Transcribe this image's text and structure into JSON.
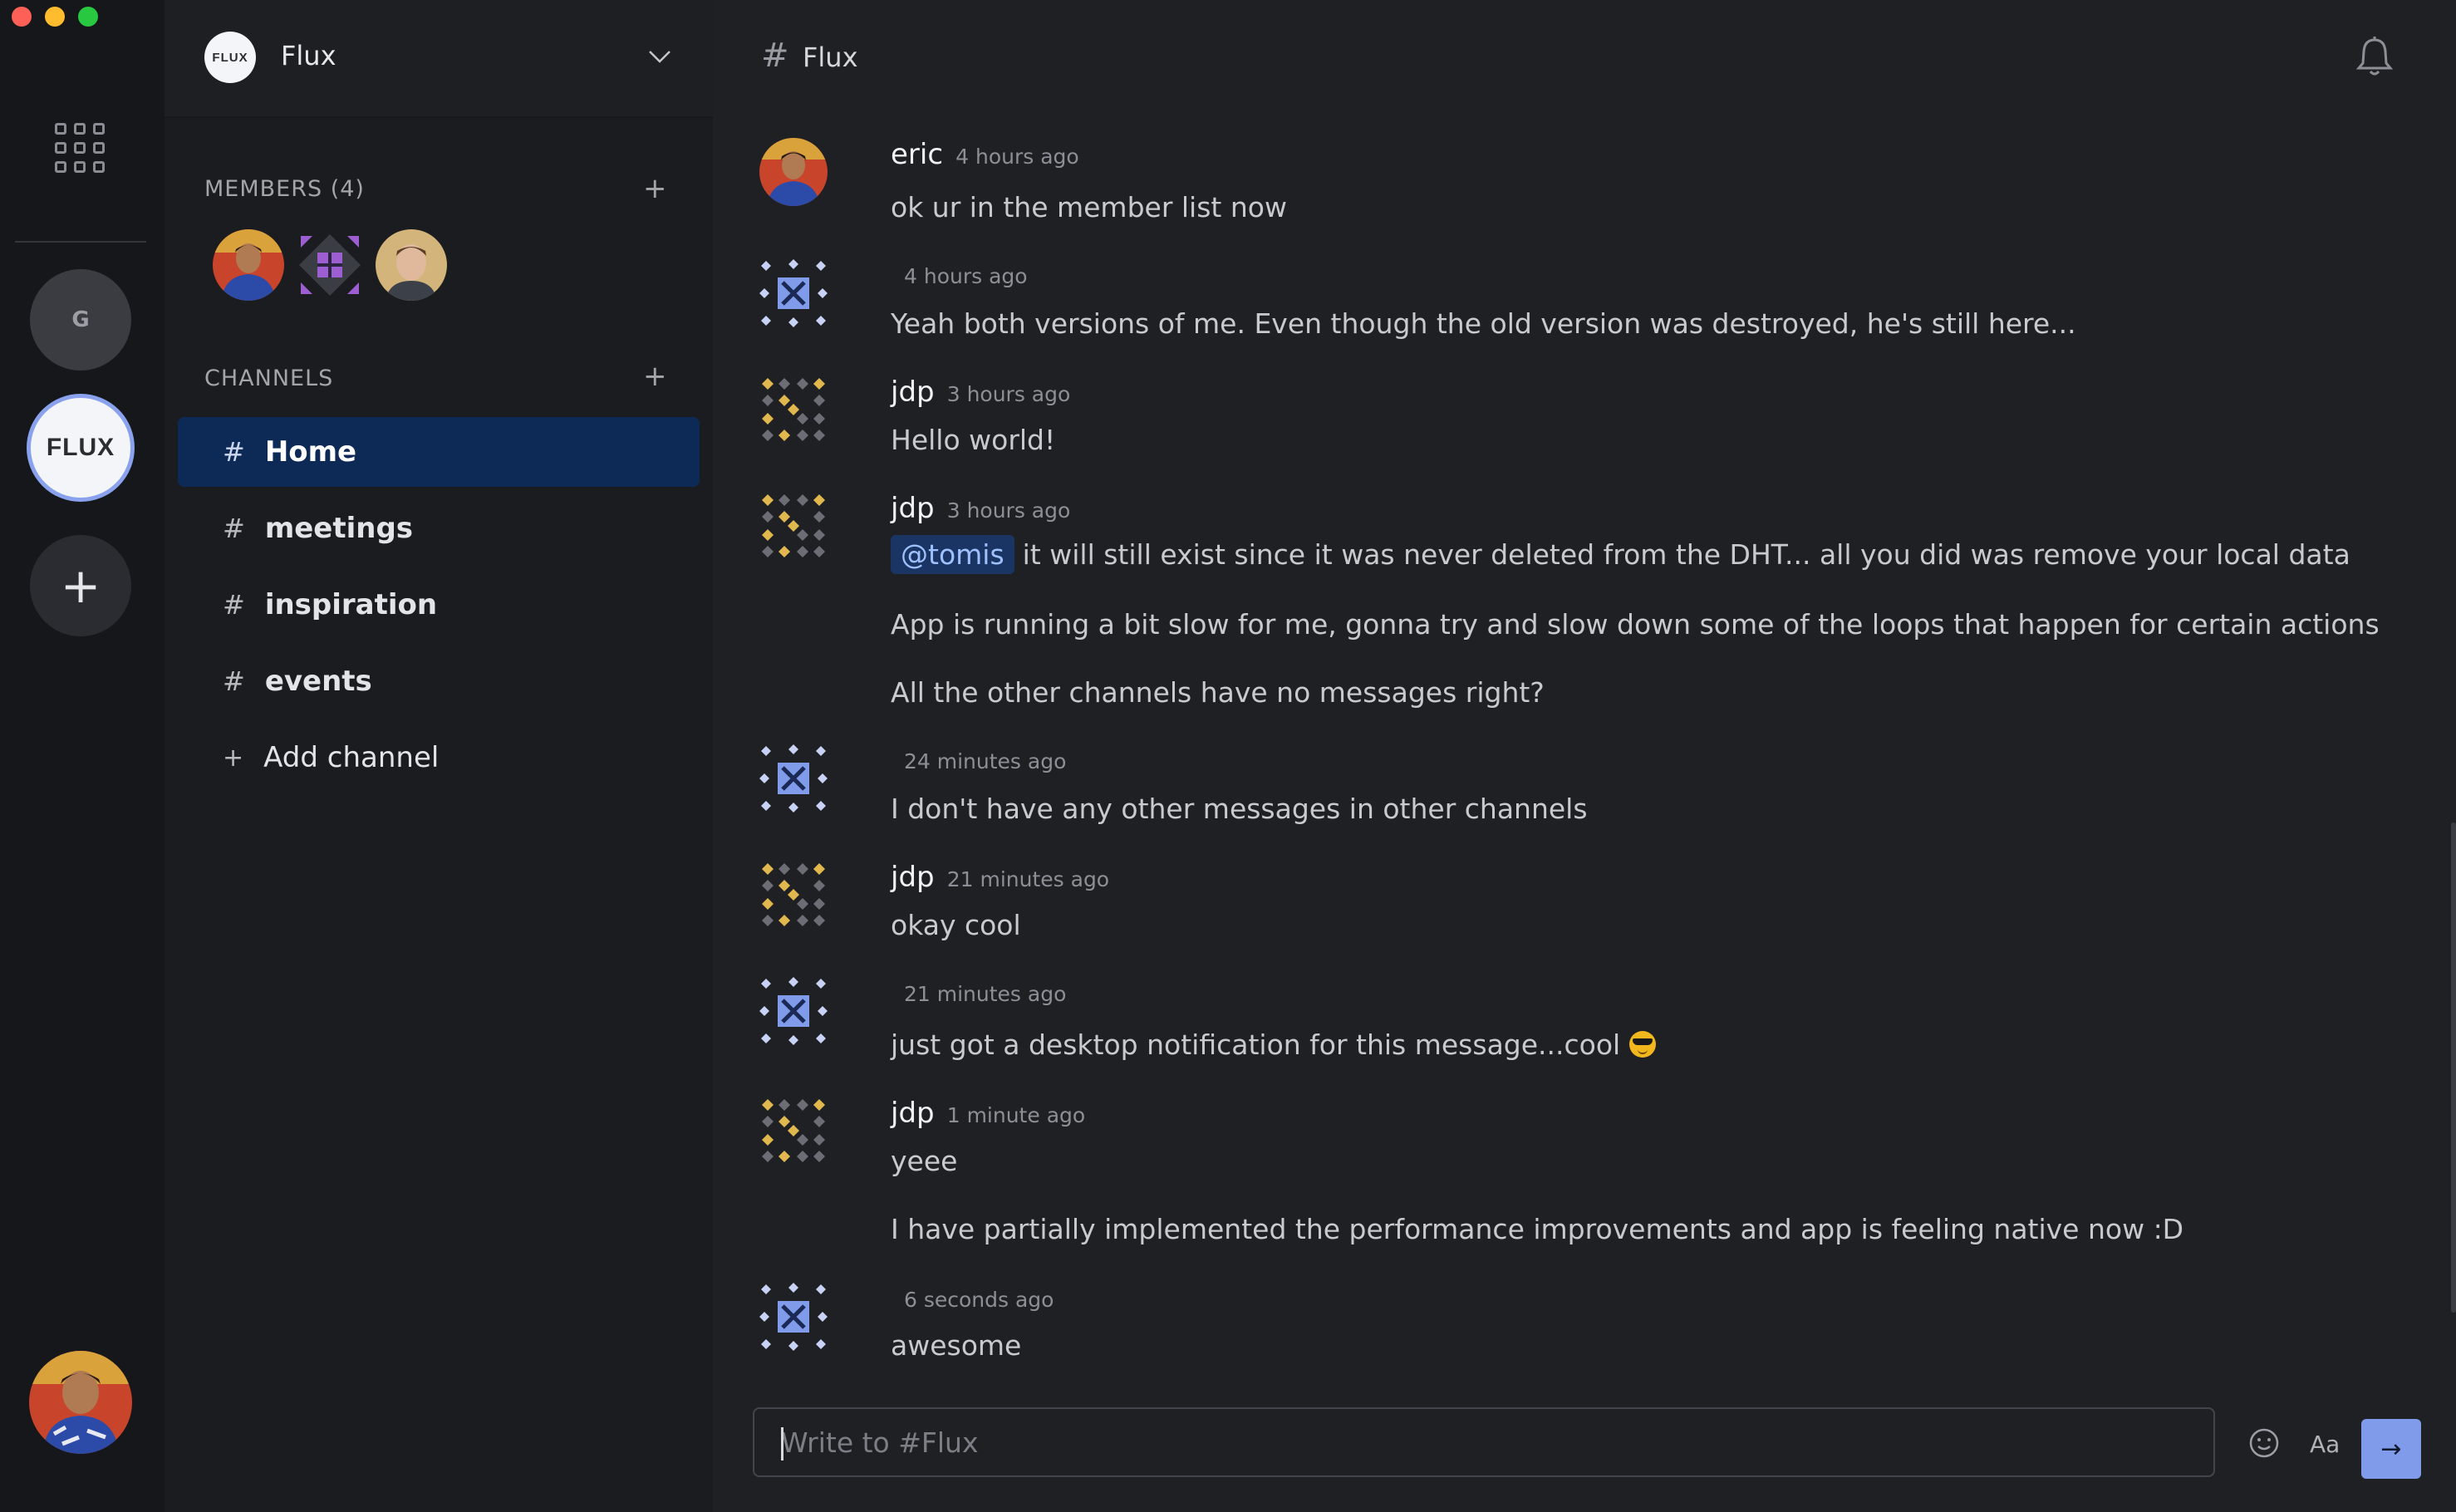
{
  "rail": {
    "servers": [
      {
        "label": "G"
      },
      {
        "label": "FLUX"
      }
    ],
    "add_label": "+"
  },
  "sidebar": {
    "community_name": "Flux",
    "logo_text": "FLUX",
    "members_label": "MEMBERS (4)",
    "channels_label": "CHANNELS",
    "add_symbol": "+",
    "channels": [
      {
        "name": "Home",
        "active": true
      },
      {
        "name": "meetings",
        "active": false
      },
      {
        "name": "inspiration",
        "active": false
      },
      {
        "name": "events",
        "active": false
      }
    ],
    "add_channel_label": "Add channel"
  },
  "header": {
    "hash": "#",
    "channel_title": "Flux"
  },
  "messages": [
    {
      "author": "eric",
      "time": "4 hours ago",
      "lines": [
        "ok ur in the member list now"
      ]
    },
    {
      "author": "",
      "time": "4 hours ago",
      "lines": [
        "Yeah both versions of me. Even though the old version was destroyed, he's still here..."
      ]
    },
    {
      "author": "jdp",
      "time": "3 hours ago",
      "lines": [
        "Hello world!"
      ]
    },
    {
      "author": "jdp",
      "time": "3 hours ago",
      "mention": "@tomis",
      "lines": [
        "it will still exist since it was never deleted from the DHT... all you did was remove your local data",
        "App is running a bit slow for me, gonna try and slow down some of the loops that happen for certain actions",
        "All the other channels have no messages right?"
      ]
    },
    {
      "author": "",
      "time": "24 minutes ago",
      "lines": [
        "I don't have any other messages in other channels"
      ]
    },
    {
      "author": "jdp",
      "time": "21 minutes ago",
      "lines": [
        "okay cool"
      ]
    },
    {
      "author": "",
      "time": "21 minutes ago",
      "lines": [
        "just got a desktop notification for this message...cool"
      ]
    },
    {
      "author": "jdp",
      "time": "1 minute ago",
      "lines": [
        "yeee",
        "I have partially implemented the performance improvements and app is feeling native now :D"
      ]
    },
    {
      "author": "",
      "time": "6 seconds ago",
      "lines": [
        "awesome"
      ]
    }
  ],
  "composer": {
    "placeholder": "Write to #Flux",
    "format_label": "Aa",
    "send_symbol": "→"
  },
  "icons": {
    "apps": "grid-icon",
    "notifications": "bell-icon",
    "emoji": "smiley-icon",
    "dropdown": "chevron-down-icon"
  },
  "colors": {
    "accent": "#7f9bea",
    "active_channel": "#0d2a57",
    "mention_bg": "#1a3563"
  }
}
